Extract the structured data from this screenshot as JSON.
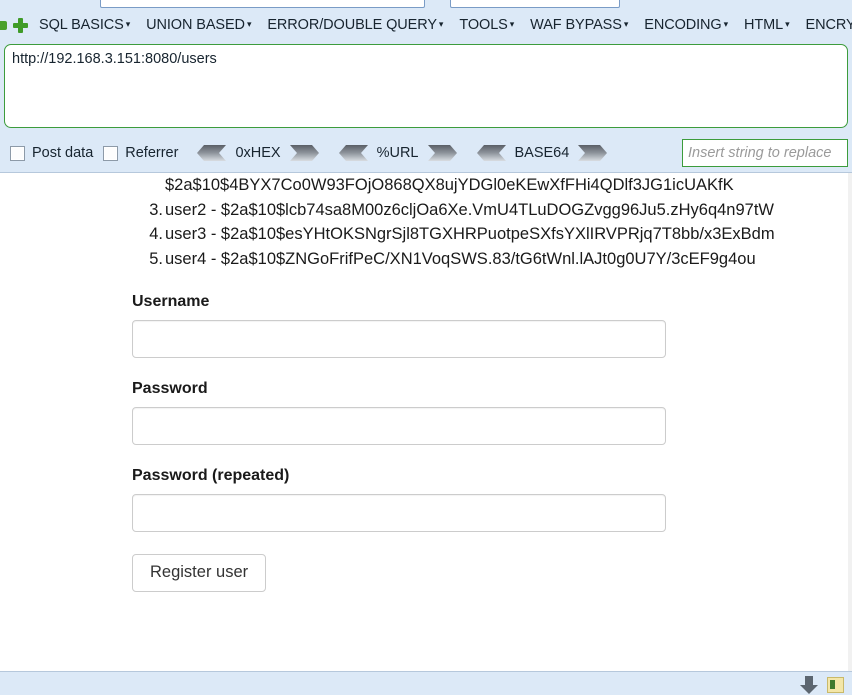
{
  "hackbar": {
    "icons": [
      "green-square-icon",
      "green-plus-icon"
    ],
    "menu": [
      {
        "label": "SQL BASICS",
        "caret": "▾"
      },
      {
        "label": "UNION BASED",
        "caret": "▾"
      },
      {
        "label": "ERROR/DOUBLE QUERY",
        "caret": "▾"
      },
      {
        "label": "TOOLS",
        "caret": "▾"
      },
      {
        "label": "WAF BYPASS",
        "caret": "▾"
      },
      {
        "label": "ENCODING",
        "caret": "▾"
      },
      {
        "label": "HTML",
        "caret": "▾"
      },
      {
        "label": "ENCRY",
        "caret": ""
      }
    ],
    "url_value": "http://192.168.3.151:8080/users",
    "url_placeholder": "",
    "checkboxes": [
      {
        "label": "Post data",
        "checked": false
      },
      {
        "label": "Referrer",
        "checked": false
      }
    ],
    "encoders": [
      {
        "label": "0xHEX"
      },
      {
        "label": "%URL"
      },
      {
        "label": "BASE64"
      }
    ],
    "replace_value": "",
    "replace_placeholder": "Insert string to replace"
  },
  "page": {
    "users": [
      {
        "number": "",
        "name": "",
        "hash": "$2a$10$4BYX7Co0W93FOjO868QX8ujYDGl0eKEwXfFHi4QDlf3JG1icUAKfK",
        "text": "$2a$10$4BYX7Co0W93FOjO868QX8ujYDGl0eKEwXfFHi4QDlf3JG1icUAKfK",
        "partial": true
      },
      {
        "number": "3.",
        "name": "user2",
        "hash": "$2a$10$lcb74sa8M00z6cljOa6Xe.VmU4TLuDOGZvgg96Ju5.zHy6q4n97tW",
        "text": "user2 - $2a$10$lcb74sa8M00z6cljOa6Xe.VmU4TLuDOGZvgg96Ju5.zHy6q4n97tW",
        "partial": false
      },
      {
        "number": "4.",
        "name": "user3",
        "hash": "$2a$10$esYHtOKSNgrSjl8TGXHRPuotpeSXfsYXlIRVPRjq7T8bb/x3ExBdm",
        "text": "user3 - $2a$10$esYHtOKSNgrSjl8TGXHRPuotpeSXfsYXlIRVPRjq7T8bb/x3ExBdm",
        "partial": false
      },
      {
        "number": "5.",
        "name": "user4",
        "hash": "$2a$10$ZNGoFrifPeC/XN1VoqSWS.83/tG6tWnl.lAJt0g0U7Y/3cEF9g4ou",
        "text": "user4 - $2a$10$ZNGoFrifPeC/XN1VoqSWS.83/tG6tWnl.lAJt0g0U7Y/3cEF9g4ou",
        "partial": false
      }
    ],
    "form": {
      "username_label": "Username",
      "username_value": "",
      "password_label": "Password",
      "password_value": "",
      "password_repeat_label": "Password (repeated)",
      "password_repeat_value": "",
      "submit_label": "Register user"
    }
  },
  "statusbar": {
    "download_icon": "download-arrow-icon",
    "addon_icon": "addon-chip-icon"
  },
  "colors": {
    "panel_bg": "#dce9f7",
    "accent_green": "#3c9c3c",
    "icon_green": "#4aa02c",
    "text": "#17242f",
    "input_border": "#cccccc"
  }
}
